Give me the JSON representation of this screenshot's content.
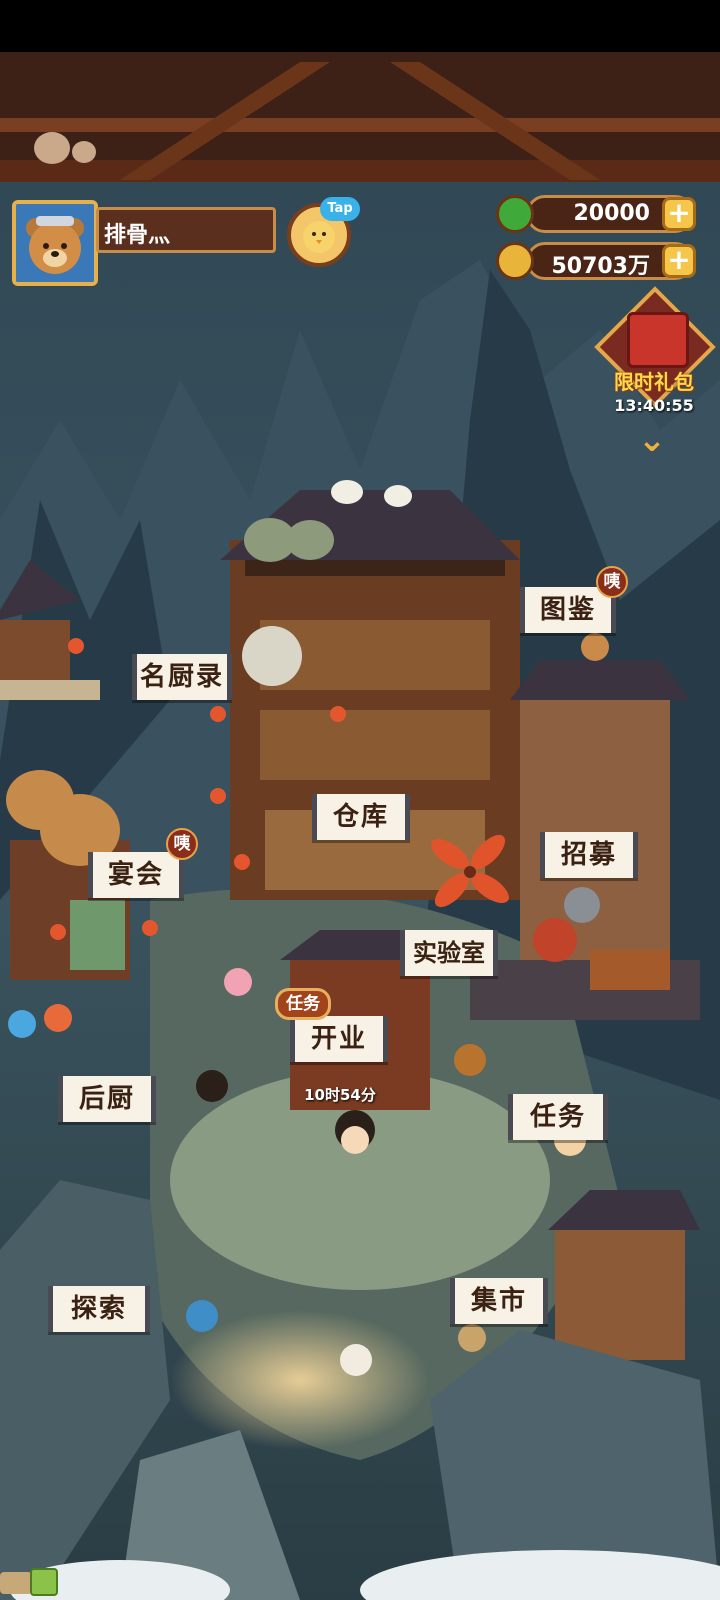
{
  "player": {
    "name": "排骨灬",
    "tap_badge": "Tap"
  },
  "currency": {
    "jade": {
      "value": "20000",
      "plus": "+"
    },
    "coins": {
      "value": "50703万",
      "plus": "+"
    }
  },
  "gift_pack": {
    "label": "限时礼包",
    "timer": "13:40:55",
    "chevron": "⌄"
  },
  "locations": {
    "tujian": "图鉴",
    "mingchulu": "名厨录",
    "cangku": "仓库",
    "yanhui": "宴会",
    "zhaomu": "招募",
    "shiyanshi": "实验室",
    "kaiye": "开业",
    "houchu": "后厨",
    "renwu": "任务",
    "tansuo": "探索",
    "jishi": "集市"
  },
  "badges": {
    "hint": "咦",
    "task_tag": "任务"
  },
  "open_timer": "10时54分",
  "colors": {
    "scroll_bg": "#f7f1e6",
    "scroll_text": "#3a2112",
    "badge": "#8a2e1a",
    "gold": "#f5c64a"
  }
}
